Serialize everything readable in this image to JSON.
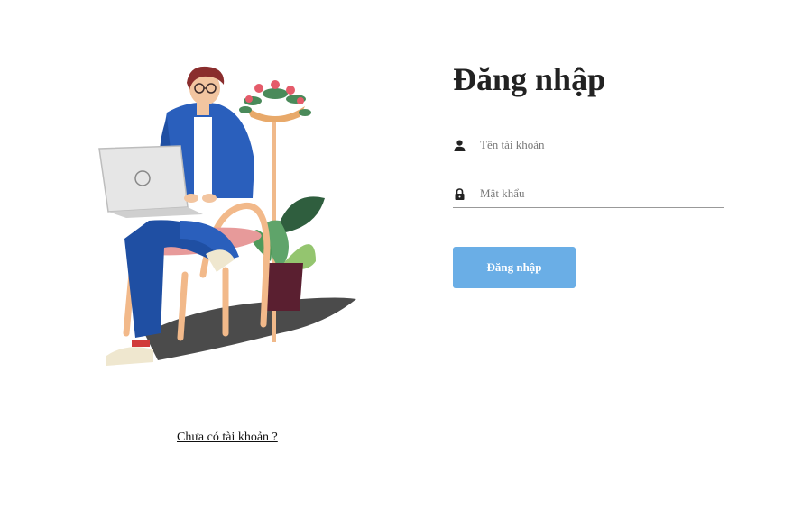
{
  "login": {
    "title": "Đăng nhập",
    "username_placeholder": "Tên tài khoản",
    "username_value": "",
    "password_placeholder": "Mật khẩu",
    "password_value": "",
    "submit_label": "Đăng nhập",
    "submit_color": "#6aaee6"
  },
  "signup": {
    "link_text": "Chưa có tài khoản ?"
  },
  "icons": {
    "username": "user-icon",
    "password": "lock-icon"
  },
  "illustration": {
    "subject": "person-with-laptop-on-chair-illustration"
  }
}
